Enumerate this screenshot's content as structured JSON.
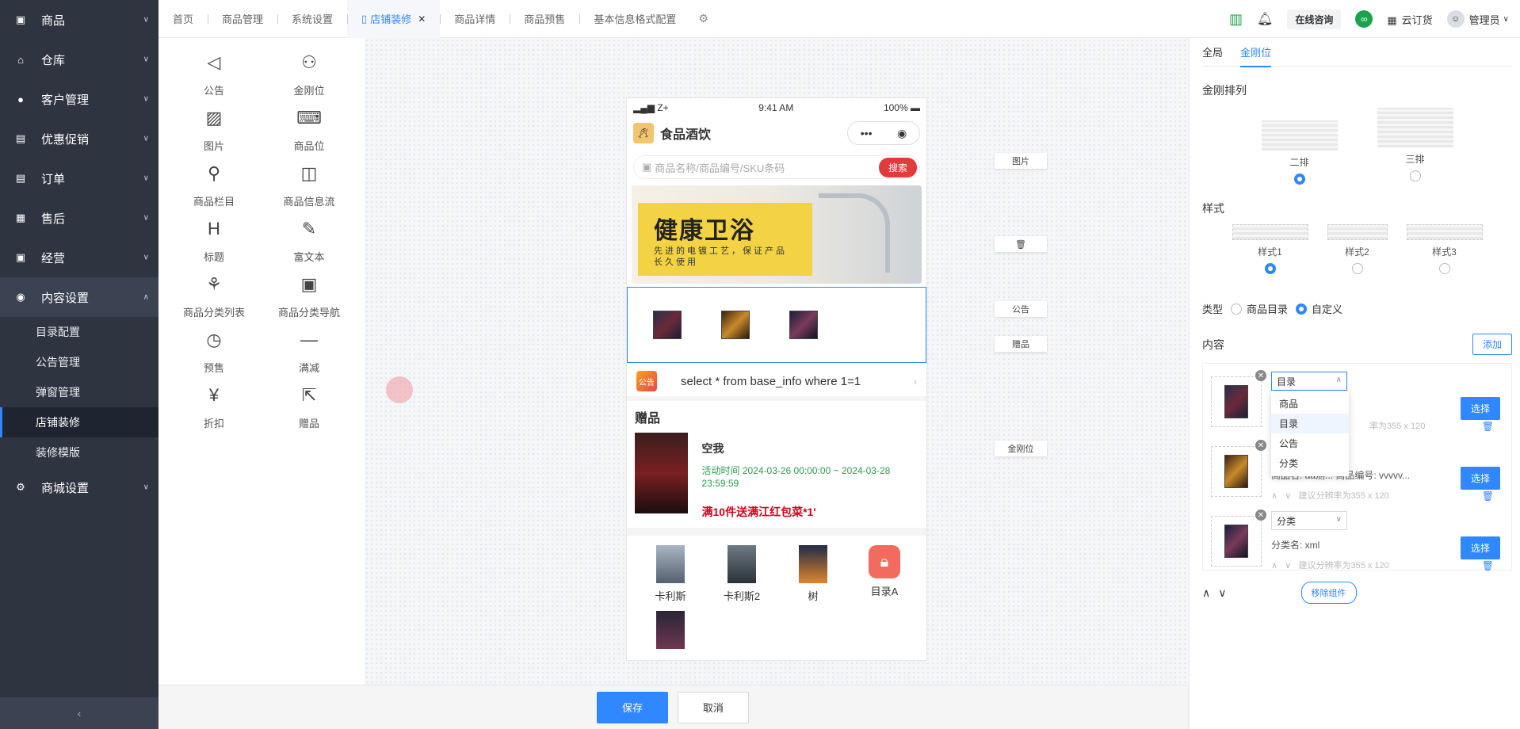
{
  "sidebar": {
    "items": [
      {
        "label": "商品",
        "icon": "box-icon"
      },
      {
        "label": "仓库",
        "icon": "warehouse-icon"
      },
      {
        "label": "客户管理",
        "icon": "user-icon"
      },
      {
        "label": "优惠促销",
        "icon": "promo-icon"
      },
      {
        "label": "订单",
        "icon": "order-icon"
      },
      {
        "label": "售后",
        "icon": "aftersale-icon"
      },
      {
        "label": "经营",
        "icon": "business-icon"
      },
      {
        "label": "内容设置",
        "icon": "eye-icon"
      }
    ],
    "content_sub": [
      "目录配置",
      "公告管理",
      "弹窗管理",
      "店铺装修",
      "装修模版"
    ],
    "mall_setting": {
      "label": "商城设置",
      "icon": "gear-icon"
    },
    "collapse": "‹"
  },
  "tabs": [
    "首页",
    "商品管理",
    "系统设置",
    "店铺装修",
    "商品详情",
    "商品预售",
    "基本信息格式配置"
  ],
  "active_tab": "店铺装修",
  "topright": {
    "consult": "在线咨询",
    "cloud": "云订货",
    "user": "管理员"
  },
  "widgets": [
    {
      "label": "公告",
      "icon": "megaphone-icon",
      "glyph": "◁"
    },
    {
      "label": "金刚位",
      "icon": "users-icon",
      "glyph": "⚇"
    },
    {
      "label": "图片",
      "icon": "image-icon",
      "glyph": "▨"
    },
    {
      "label": "商品位",
      "icon": "code-icon",
      "glyph": "⌨"
    },
    {
      "label": "商品栏目",
      "icon": "user-add-icon",
      "glyph": "⚲"
    },
    {
      "label": "商品信息流",
      "icon": "bag-icon",
      "glyph": "◫"
    },
    {
      "label": "标题",
      "icon": "heading-icon",
      "glyph": "H"
    },
    {
      "label": "富文本",
      "icon": "edit-icon",
      "glyph": "✎"
    },
    {
      "label": "商品分类列表",
      "icon": "grid-icon",
      "glyph": "⚘"
    },
    {
      "label": "商品分类导航",
      "icon": "save-check-icon",
      "glyph": "▣"
    },
    {
      "label": "预售",
      "icon": "clock-icon",
      "glyph": "◷"
    },
    {
      "label": "满减",
      "icon": "minus-icon",
      "glyph": "—"
    },
    {
      "label": "折扣",
      "icon": "yen-icon",
      "glyph": "¥"
    },
    {
      "label": "赠品",
      "icon": "export-icon",
      "glyph": "⇱"
    }
  ],
  "phone": {
    "time": "9:41 AM",
    "carrier": "Z+",
    "battery": "100%",
    "app_title": "食品酒饮",
    "search_placeholder": "商品名称/商品编号/SKU条码",
    "search_btn": "搜索",
    "banner_title": "健康卫浴",
    "banner_sub": "先进的电镀工艺，保证产品长久使用",
    "notice_tag": "公告",
    "notice_text": "select * from base_info where 1=1",
    "gift_section": "赠品",
    "gift_name": "空我",
    "gift_time": "活动时间 2024-03-26 00:00:00 ~ 2024-03-28 23:59:59",
    "gift_promo": "满10件送满江红包菜*1'",
    "kk_items": [
      "卡利斯",
      "卡利斯2",
      "树",
      "目录A"
    ]
  },
  "canvas_labels": [
    "图片",
    "公告",
    "赠品",
    "金刚位"
  ],
  "footer": {
    "save": "保存",
    "cancel": "取消"
  },
  "rpanel": {
    "tabs": [
      "全局",
      "金刚位"
    ],
    "layout_title": "金刚排列",
    "layout_opts": [
      "二排",
      "三排"
    ],
    "style_title": "样式",
    "style_opts": [
      "样式1",
      "样式2",
      "样式3"
    ],
    "type_label": "类型",
    "type_opts": [
      "商品目录",
      "自定义"
    ],
    "content_title": "内容",
    "add_btn": "添加",
    "items": [
      {
        "select": "目录",
        "info": "",
        "hint": "建议分辨率为355 x 120"
      },
      {
        "select": "",
        "info": "商品名: aa测...    商品编号: vvvvv...",
        "hint": "建议分辨率为355 x 120"
      },
      {
        "select": "分类",
        "info": "分类名:    xml",
        "hint": "建议分辨率为355 x 120"
      }
    ],
    "item1_hint_tail": "率为355 x 120",
    "choose_btn": "选择",
    "dropdown": [
      "商品",
      "目录",
      "公告",
      "分类"
    ],
    "remove_btn": "移除组件"
  }
}
